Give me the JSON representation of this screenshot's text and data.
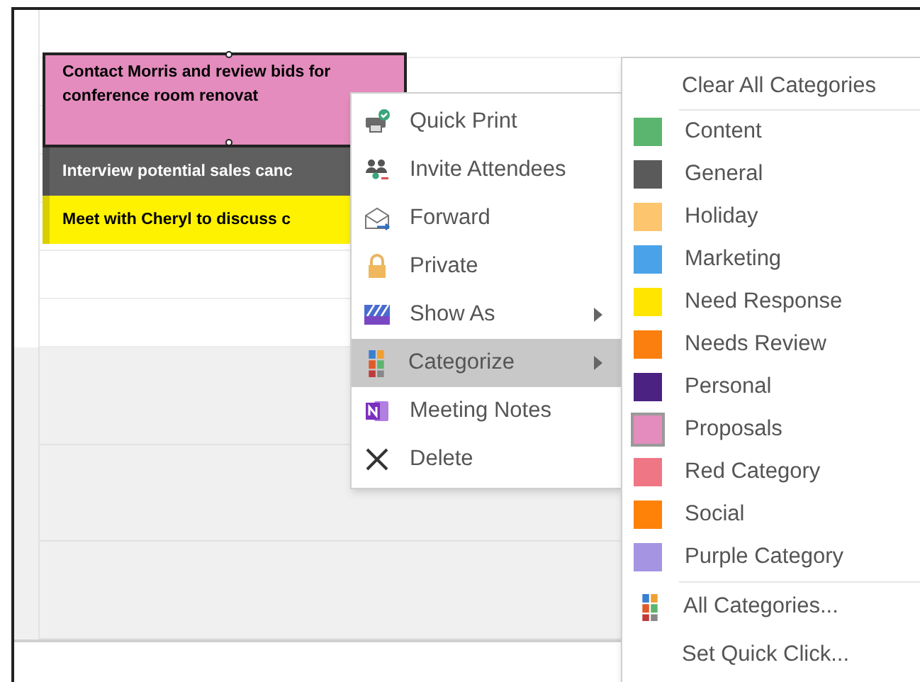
{
  "events": [
    {
      "text": "Contact Morris and review bids for conference room renovat",
      "color": "#e38cbd",
      "selected": true
    },
    {
      "text": "Interview potential sales canc",
      "color": "#5f5f5f",
      "selected": false
    },
    {
      "text": "Meet with Cheryl to discuss c",
      "color": "#fff200",
      "selected": false
    }
  ],
  "context_menu": {
    "items": [
      {
        "label": "Quick Print",
        "highlighted": false,
        "submenu": false
      },
      {
        "label": "Invite Attendees",
        "highlighted": false,
        "submenu": false
      },
      {
        "label": "Forward",
        "highlighted": false,
        "submenu": false
      },
      {
        "label": "Private",
        "highlighted": false,
        "submenu": false
      },
      {
        "label": "Show As",
        "highlighted": false,
        "submenu": true
      },
      {
        "label": "Categorize",
        "highlighted": true,
        "submenu": true
      },
      {
        "label": "Meeting Notes",
        "highlighted": false,
        "submenu": false
      },
      {
        "label": "Delete",
        "highlighted": false,
        "submenu": false
      }
    ]
  },
  "categorize_menu": {
    "clear": {
      "label": "Clear All Categories"
    },
    "categories": [
      {
        "label": "Content",
        "color": "#5cb56f",
        "checked": false
      },
      {
        "label": "General",
        "color": "#5a5a5a",
        "checked": false
      },
      {
        "label": "Holiday",
        "color": "#fcc56e",
        "checked": false
      },
      {
        "label": "Marketing",
        "color": "#4aa3e8",
        "checked": false
      },
      {
        "label": "Need Response",
        "color": "#ffe500",
        "checked": false
      },
      {
        "label": "Needs Review",
        "color": "#fb7f0e",
        "checked": false
      },
      {
        "label": "Personal",
        "color": "#4b2182",
        "checked": false
      },
      {
        "label": "Proposals",
        "color": "#e38cbd",
        "checked": true
      },
      {
        "label": "Red Category",
        "color": "#ef7684",
        "checked": false
      },
      {
        "label": "Social",
        "color": "#fd8207",
        "checked": false
      },
      {
        "label": "Purple Category",
        "color": "#a594e2",
        "checked": false
      }
    ],
    "all": {
      "label": "All Categories..."
    },
    "quick_click": {
      "label": "Set Quick Click..."
    }
  }
}
